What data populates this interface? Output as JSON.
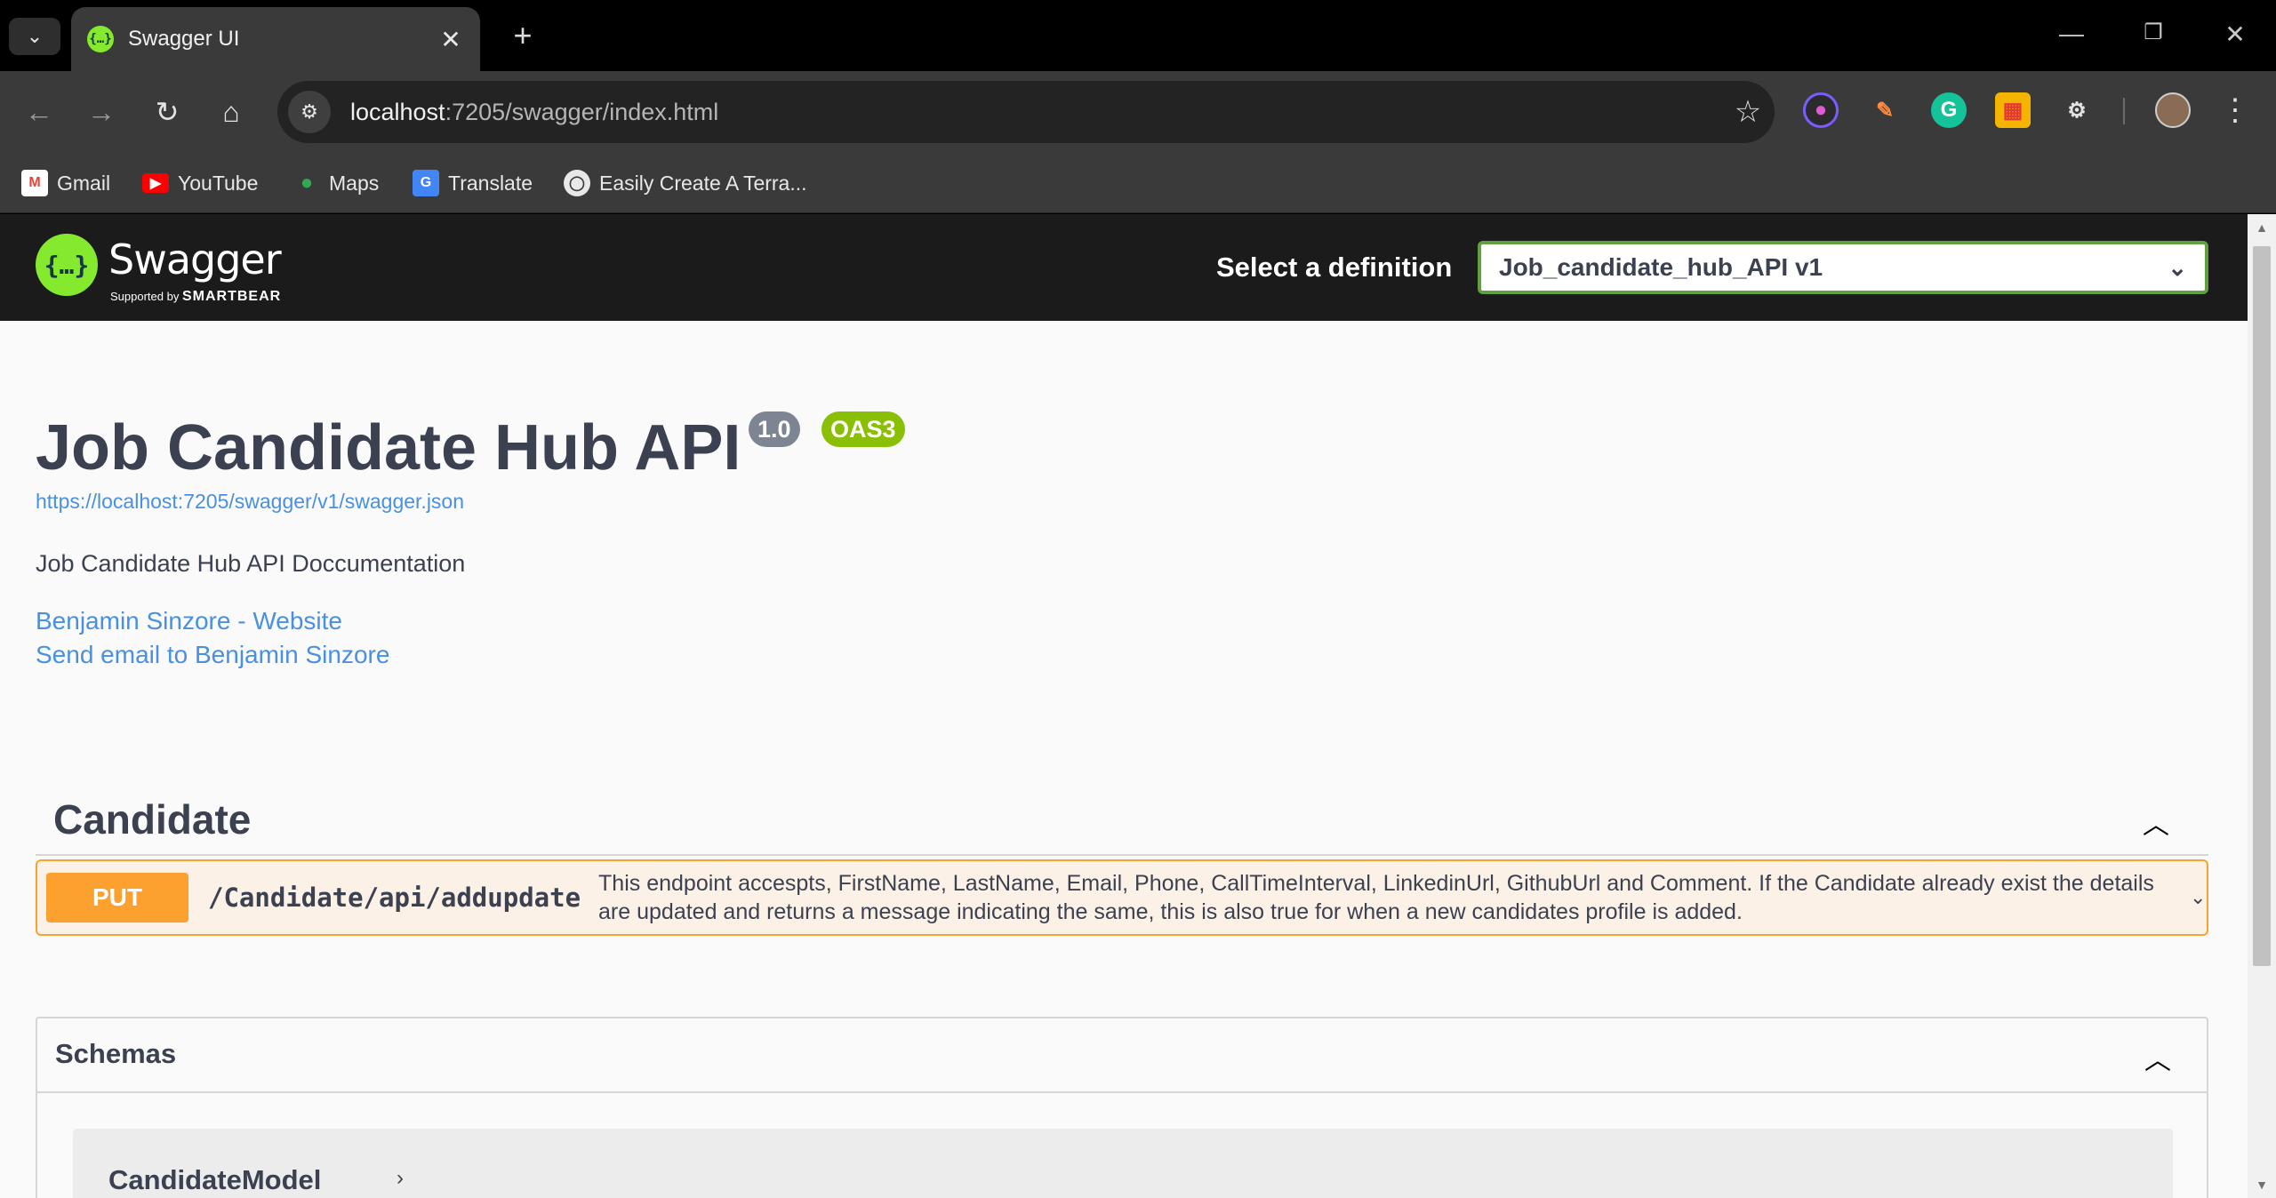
{
  "browser": {
    "tab": {
      "title": "Swagger UI"
    },
    "url": {
      "host": "localhost",
      "rest": ":7205/swagger/index.html"
    },
    "bookmarks": [
      {
        "label": "Gmail",
        "icon": "gmail-icon"
      },
      {
        "label": "YouTube",
        "icon": "youtube-icon"
      },
      {
        "label": "Maps",
        "icon": "maps-icon"
      },
      {
        "label": "Translate",
        "icon": "translate-icon"
      },
      {
        "label": "Easily Create A Terra...",
        "icon": "globe-icon"
      }
    ]
  },
  "swagger": {
    "brand": "Swagger",
    "supported_by": "Supported by",
    "smartbear": "SMARTBEAR",
    "definition_label": "Select a definition",
    "definition_value": "Job_candidate_hub_API v1",
    "accent_color": "#85ea2d"
  },
  "info": {
    "title": "Job Candidate Hub API",
    "version": "1.0",
    "oas": "OAS3",
    "spec_url": "https://localhost:7205/swagger/v1/swagger.json",
    "description": "Job Candidate Hub API Doccumentation",
    "contact_website": "Benjamin Sinzore - Website",
    "contact_email": "Send email to Benjamin Sinzore"
  },
  "tags": [
    {
      "name": "Candidate",
      "operations": [
        {
          "method": "PUT",
          "path": "/Candidate/api/addupdate",
          "summary": "This endpoint accespts, FirstName, LastName, Email, Phone, CallTimeInterval, LinkedinUrl, GithubUrl and Comment. If the Candidate already exist the details are updated and returns a message indicating the same, this is also true for when a new candidates profile is added.",
          "color": "#fca130"
        }
      ]
    }
  ],
  "schemas": {
    "title": "Schemas",
    "models": [
      {
        "name": "CandidateModel"
      }
    ]
  }
}
